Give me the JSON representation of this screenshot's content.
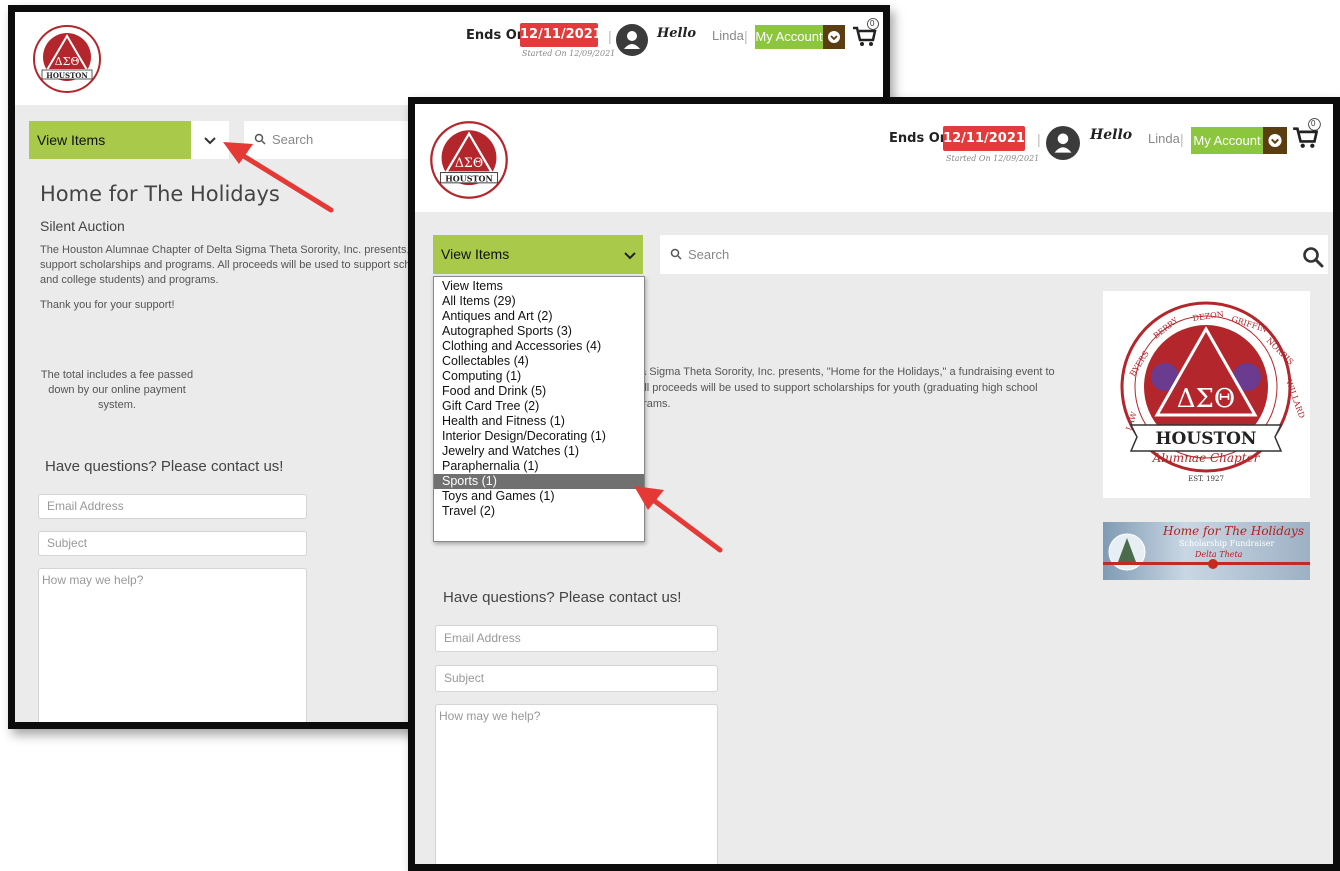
{
  "back_window": {
    "header": {
      "ends_on_label": "Ends On",
      "end_date": "12/11/2021",
      "started_text": "Started On 12/09/2021",
      "separator": "|",
      "hello": "Hello",
      "username": "Linda",
      "account_button": "My Account",
      "cart_count": "0"
    },
    "view_items": "View Items",
    "search_placeholder": "Search",
    "page_title": "Home for The Holidays",
    "subtitle": "Silent Auction",
    "description": "The Houston Alumnae Chapter of Delta Sigma Theta Sorority, Inc. presents, \"Home for the Holidays,\" a fundraising event to support scholarships and programs. All proceeds will be used to support scholarships for youth (graduating high school seniors and college students) and programs.",
    "thanks": "Thank you for your support!",
    "fee_note": "The total includes a fee passed down by our online payment system.",
    "contact_heading": "Have questions? Please contact us!",
    "email_placeholder": "Email Address",
    "subject_placeholder": "Subject",
    "message_placeholder": "How may we help?"
  },
  "front_window": {
    "header": {
      "ends_on_label": "Ends On",
      "end_date": "12/11/2021",
      "started_text": "Started On 12/09/2021",
      "separator": "|",
      "hello": "Hello",
      "username": "Linda",
      "account_button": "My Account",
      "cart_count": "0"
    },
    "view_items": "View Items",
    "search_placeholder": "Search",
    "description_line1": "ta Sigma Theta Sorority, Inc. presents, \"Home for the Holidays,\" a fundraising event to",
    "description_line2": "All proceeds will be used to support scholarships for youth (graduating high school",
    "description_line3": "grams.",
    "contact_heading": "Have questions? Please contact us!",
    "email_placeholder": "Email Address",
    "subject_placeholder": "Subject",
    "message_placeholder": "How may we help?",
    "dropdown_options": [
      "View Items",
      "All Items  (29)",
      "Antiques and Art  (2)",
      "Autographed Sports  (3)",
      "Clothing and Accessories  (4)",
      "Collectables  (4)",
      "Computing  (1)",
      "Food and Drink  (5)",
      "Gift Card Tree  (2)",
      "Health and Fitness  (1)",
      "Interior Design/Decorating  (1)",
      "Jewelry and Watches  (1)",
      "Paraphernalia  (1)",
      "Sports  (1)",
      "Toys and Games  (1)",
      "Travel  (2)"
    ],
    "highlighted_option": "Sports  (1)",
    "logo": {
      "names": [
        "LAW",
        "BYERS",
        "BERRY",
        "DEZON",
        "GRIFFIN",
        "NORRIS",
        "WILLARD"
      ],
      "letters": "ΔΣΘ",
      "city": "HOUSTON",
      "chapter": "Alumnae Chapter",
      "est": "EST. 1927"
    },
    "banner": {
      "title": "Home for The Holidays",
      "subtitle": "Scholarship Fundraiser",
      "brand": "Delta Theta"
    }
  },
  "colors": {
    "accent_green": "#8cc63f",
    "view_items_green": "#a8c94a",
    "date_red": "#e23b3b",
    "annotation_arrow": "#e53935",
    "logo_red": "#b3262b"
  }
}
